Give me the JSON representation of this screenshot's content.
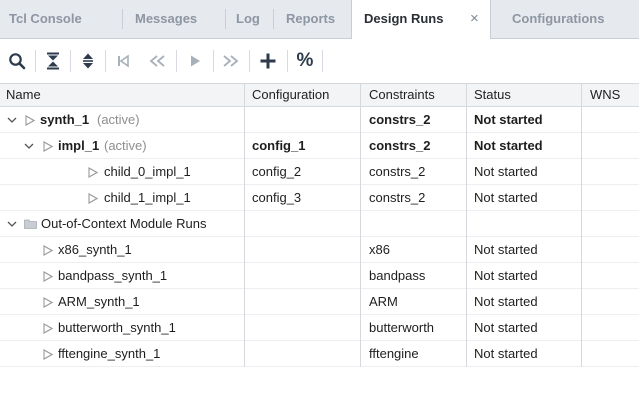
{
  "tabs": [
    {
      "label": "Tcl Console"
    },
    {
      "label": "Messages"
    },
    {
      "label": "Log"
    },
    {
      "label": "Reports"
    },
    {
      "label": "Design Runs"
    },
    {
      "label": "Configurations"
    }
  ],
  "active_tab_index": 4,
  "close_glyph": "×",
  "toolbar": {
    "icons": [
      "search-icon",
      "collapse-all-icon",
      "expand-all-icon",
      "first-icon",
      "previous-icon",
      "play-icon",
      "next-icon",
      "add-icon"
    ],
    "percent_label": "%"
  },
  "columns": [
    "Name",
    "Configuration",
    "Constraints",
    "Status",
    "WNS"
  ],
  "rows": [
    {
      "name": "synth_1",
      "tag": "(active)",
      "configuration": "",
      "constraints": "constrs_2",
      "status": "Not started",
      "wns": ""
    },
    {
      "name": "impl_1",
      "tag": "(active)",
      "configuration": "config_1",
      "constraints": "constrs_2",
      "status": "Not started",
      "wns": ""
    },
    {
      "name": "child_0_impl_1",
      "tag": "",
      "configuration": "config_2",
      "constraints": "constrs_2",
      "status": "Not started",
      "wns": ""
    },
    {
      "name": "child_1_impl_1",
      "tag": "",
      "configuration": "config_3",
      "constraints": "constrs_2",
      "status": "Not started",
      "wns": ""
    },
    {
      "name": "Out-of-Context Module Runs",
      "tag": "",
      "configuration": "",
      "constraints": "",
      "status": "",
      "wns": ""
    },
    {
      "name": "x86_synth_1",
      "tag": "",
      "configuration": "",
      "constraints": "x86",
      "status": "Not started",
      "wns": ""
    },
    {
      "name": "bandpass_synth_1",
      "tag": "",
      "configuration": "",
      "constraints": "bandpass",
      "status": "Not started",
      "wns": ""
    },
    {
      "name": "ARM_synth_1",
      "tag": "",
      "configuration": "",
      "constraints": "ARM",
      "status": "Not started",
      "wns": ""
    },
    {
      "name": "butterworth_synth_1",
      "tag": "",
      "configuration": "",
      "constraints": "butterworth",
      "status": "Not started",
      "wns": ""
    },
    {
      "name": "fftengine_synth_1",
      "tag": "",
      "configuration": "",
      "constraints": "fftengine",
      "status": "Not started",
      "wns": ""
    }
  ],
  "colors": {
    "accent": "#2a7fd4",
    "tab_bar": "#e6e9ee",
    "header": "#f3f4f6",
    "inactive_tab_text": "#8d96a3"
  }
}
